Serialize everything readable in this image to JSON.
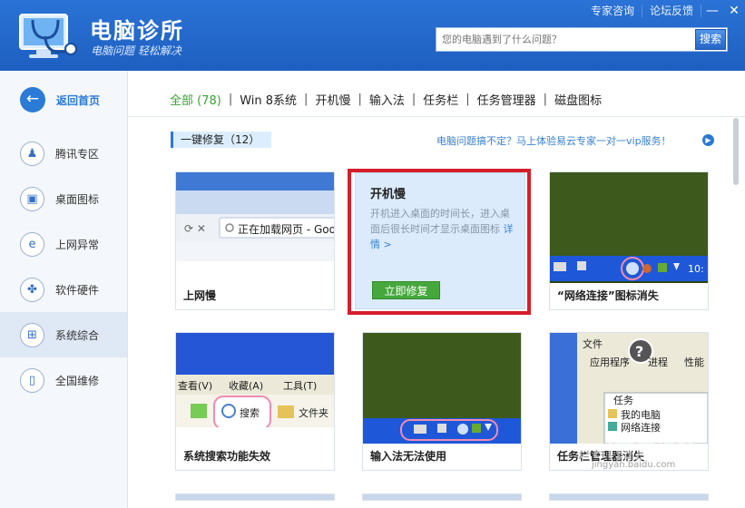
{
  "app": {
    "title": "电脑诊所",
    "slogan": "电脑问题 轻松解决"
  },
  "toplinks": [
    "专家咨询",
    "论坛反馈"
  ],
  "window_buttons": {
    "minimize": "—",
    "close": "✕"
  },
  "search": {
    "placeholder": "您的电脑遇到了什么问题？",
    "button": "搜索"
  },
  "sidebar": {
    "back_label": "返回首页",
    "items": [
      {
        "label": "腾讯专区",
        "icon": "qq-icon"
      },
      {
        "label": "桌面图标",
        "icon": "desktop-icon"
      },
      {
        "label": "上网异常",
        "icon": "ie-icon"
      },
      {
        "label": "软件硬件",
        "icon": "hardware-icon"
      },
      {
        "label": "系统综合",
        "icon": "windows-icon",
        "active": true
      },
      {
        "label": "全国维修",
        "icon": "phone-icon"
      }
    ]
  },
  "tabs": [
    "全部 (78)",
    "Win 8系统",
    "开机慢",
    "输入法",
    "任务栏",
    "任务管理器",
    "磁盘图标"
  ],
  "section": {
    "label": "一键修复（12）"
  },
  "promo": "电脑问题搞不定？马上体验易云专家一对一vip服务！",
  "cards": [
    {
      "label": "上网慢",
      "thumb_text": "正在加载网页 - Goo"
    },
    {
      "label": "开机慢",
      "highlighted": true,
      "description": "开机进入桌面的时间长，进入桌面后很长时间才显示桌面图标",
      "link": "详情 >",
      "button": "立即修复"
    },
    {
      "label": "“网络连接”图标消失",
      "thumb_text": "10:"
    },
    {
      "label": "系统搜索功能失效",
      "thumb_menu": [
        "查看(V)",
        "收藏(A)",
        "工具(T)"
      ],
      "thumb_search": "搜索",
      "thumb_folder": "文件夹"
    },
    {
      "label": "输入法无法使用"
    },
    {
      "label": "任务栏管理器消失",
      "thumb_menu": [
        "文件",
        "应用程序",
        "进程",
        "性能"
      ],
      "thumb_list_title": "任务",
      "thumb_list": [
        "我的电脑",
        "网络连接"
      ]
    }
  ],
  "watermark": {
    "text": "Bai百度经验",
    "url": "jingyan.baidu.com"
  },
  "colors": {
    "brand": "#1d5fc0",
    "accent": "#2a7ad6",
    "green": "#3aa135",
    "highlight": "#d61e2a"
  }
}
